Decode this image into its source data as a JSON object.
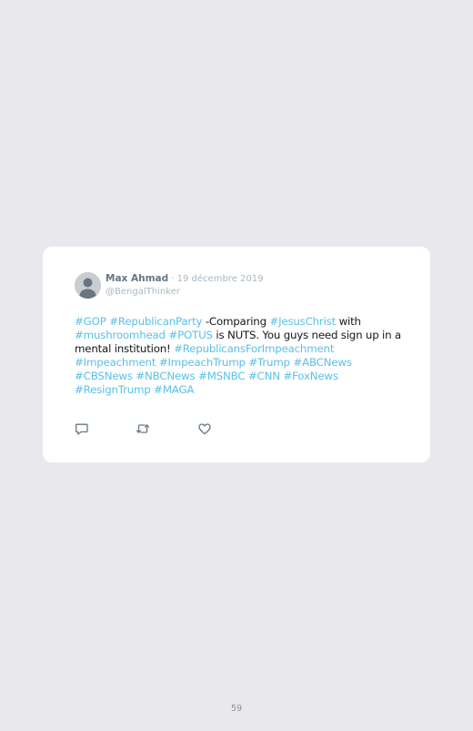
{
  "tweet": {
    "author_name": "Max Ahmad",
    "separator": " · ",
    "date": "19 décembre 2019",
    "handle": "@BengalThinker",
    "segments": [
      {
        "text": "#GOP",
        "tag": true
      },
      {
        "text": " ",
        "tag": false
      },
      {
        "text": "#RepublicanParty",
        "tag": true
      },
      {
        "text": " -Comparing ",
        "tag": false
      },
      {
        "text": "#JesusChrist",
        "tag": true
      },
      {
        "text": " with ",
        "tag": false
      },
      {
        "text": "#mushroomhead",
        "tag": true
      },
      {
        "text": " ",
        "tag": false
      },
      {
        "text": "#POTUS",
        "tag": true
      },
      {
        "text": " is NUTS. You guys need sign up in a mental institution! ",
        "tag": false
      },
      {
        "text": "#RepublicansForImpeachment",
        "tag": true
      },
      {
        "text": " ",
        "tag": false
      },
      {
        "text": "#Impeachment",
        "tag": true
      },
      {
        "text": " ",
        "tag": false
      },
      {
        "text": "#ImpeachTrump",
        "tag": true
      },
      {
        "text": " ",
        "tag": false
      },
      {
        "text": "#Trump",
        "tag": true
      },
      {
        "text": " ",
        "tag": false
      },
      {
        "text": "#ABCNews",
        "tag": true
      },
      {
        "text": " ",
        "tag": false
      },
      {
        "text": "#CBSNews",
        "tag": true
      },
      {
        "text": " ",
        "tag": false
      },
      {
        "text": "#NBCNews",
        "tag": true
      },
      {
        "text": " ",
        "tag": false
      },
      {
        "text": "#MSNBC",
        "tag": true
      },
      {
        "text": " ",
        "tag": false
      },
      {
        "text": "#CNN",
        "tag": true
      },
      {
        "text": " ",
        "tag": false
      },
      {
        "text": "#FoxNews",
        "tag": true
      },
      {
        "text": " ",
        "tag": false
      },
      {
        "text": "#ResignTrump",
        "tag": true
      },
      {
        "text": " ",
        "tag": false
      },
      {
        "text": "#MAGA",
        "tag": true
      }
    ],
    "actions": [
      {
        "name": "reply-icon"
      },
      {
        "name": "retweet-icon"
      },
      {
        "name": "like-icon"
      }
    ]
  },
  "colors": {
    "page_background": "#e9e8ed",
    "card_background": "#ffffff",
    "hashtag": "#5bc0e6",
    "text": "#14171a",
    "muted": "#aab8c2",
    "icon": "#657786"
  },
  "page": {
    "number": "59"
  }
}
